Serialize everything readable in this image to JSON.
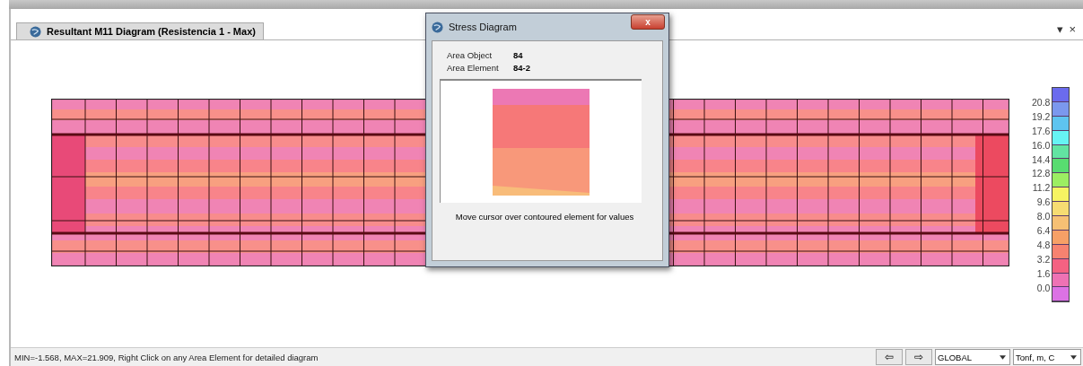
{
  "tab": {
    "title": "Resultant M11 Diagram (Resistencia 1 - Max)",
    "selected": true
  },
  "window_controls": {
    "dropdown": "▾",
    "close": "×"
  },
  "legend": {
    "swatches": [
      {
        "color": "#6b6bee"
      },
      {
        "color": "#7b98ee"
      },
      {
        "color": "#5ec4f0"
      },
      {
        "color": "#66f4f4"
      },
      {
        "color": "#62e4a2"
      },
      {
        "color": "#58dc70"
      },
      {
        "color": "#9cee62"
      },
      {
        "color": "#f6f462"
      },
      {
        "color": "#f6dc72"
      },
      {
        "color": "#f6c074"
      },
      {
        "color": "#f6a066"
      },
      {
        "color": "#f68270"
      },
      {
        "color": "#f46282"
      },
      {
        "color": "#ee72b4"
      },
      {
        "color": "#dc72e4"
      }
    ],
    "labels": [
      "20.8",
      "19.2",
      "17.6",
      "16.0",
      "14.4",
      "12.8",
      "11.2",
      "9.6",
      "8.0",
      "6.4",
      "4.8",
      "3.2",
      "1.6",
      "0.0"
    ]
  },
  "dialog": {
    "title": "Stress Diagram",
    "close": "x",
    "fields": [
      {
        "label": "Area Object",
        "value": "84"
      },
      {
        "label": "Area Element",
        "value": "84-2"
      }
    ],
    "caption": "Move cursor over contoured element for values"
  },
  "status_bar": {
    "message": "MIN=-1.568, MAX=21.909, Right Click on any Area Element for detailed diagram",
    "back": "⇦",
    "forward": "⇨",
    "coordinate_system": "GLOBAL",
    "units": "Tonf, m, C"
  }
}
